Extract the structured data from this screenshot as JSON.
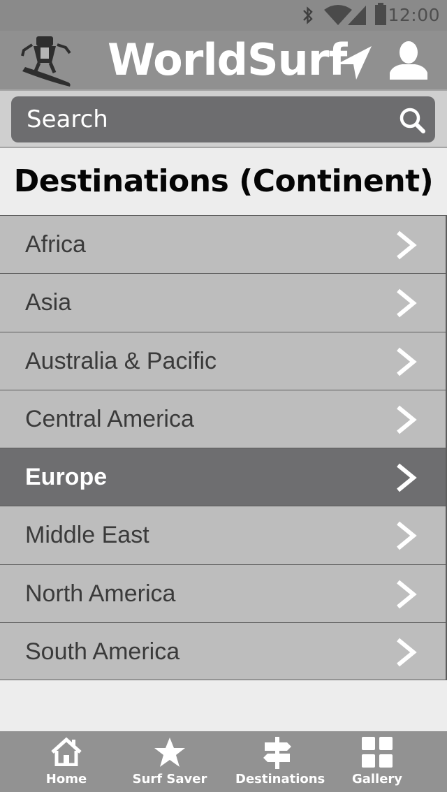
{
  "status_bar": {
    "time": "12:00",
    "icons": [
      "bluetooth-icon",
      "wifi-icon",
      "signal-icon",
      "battery-icon"
    ]
  },
  "header": {
    "title": "WorldSurf",
    "logo": "surfer-logo",
    "icons": [
      "location-arrow-icon",
      "profile-icon"
    ]
  },
  "search": {
    "placeholder": "Search",
    "icon": "search-icon"
  },
  "page": {
    "title": "Destinations (Continent)"
  },
  "continents": [
    {
      "label": "Africa",
      "selected": false
    },
    {
      "label": "Asia",
      "selected": false
    },
    {
      "label": "Australia & Pacific",
      "selected": false
    },
    {
      "label": "Central America",
      "selected": false
    },
    {
      "label": "Europe",
      "selected": true
    },
    {
      "label": "Middle East",
      "selected": false
    },
    {
      "label": "North America",
      "selected": false
    },
    {
      "label": "South America",
      "selected": false
    }
  ],
  "tabs": [
    {
      "label": "Home",
      "icon": "home-icon"
    },
    {
      "label": "Surf Saver",
      "icon": "star-icon"
    },
    {
      "label": "Destinations",
      "icon": "signpost-icon"
    },
    {
      "label": "Gallery",
      "icon": "grid-icon"
    }
  ],
  "colors": {
    "header_bg": "#909090",
    "selected_row": "#6e6e70",
    "row_bg": "#bdbdbd",
    "search_bg": "#6d6d6f"
  }
}
